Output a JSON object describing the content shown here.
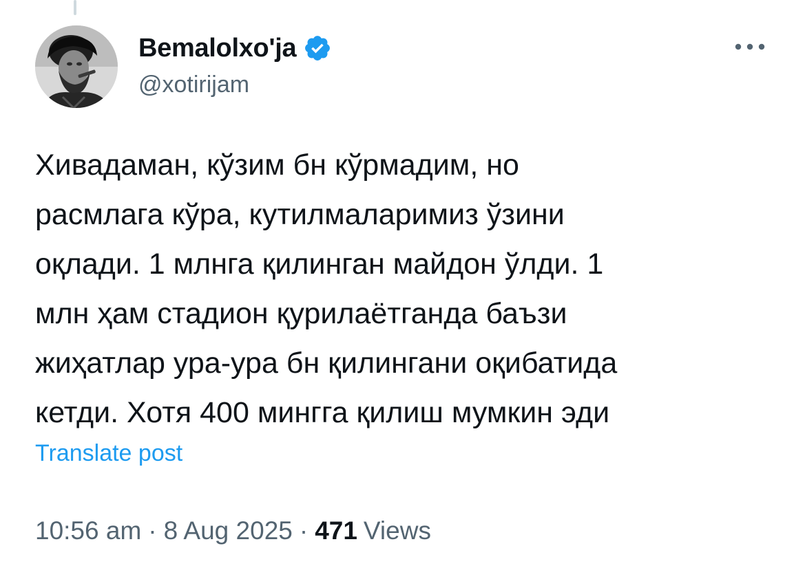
{
  "author": {
    "display_name": "Bemalolxo'ja",
    "handle": "@xotirijam",
    "verified": true,
    "avatar_icon": "avatar-photo"
  },
  "tweet": {
    "lines": [
      "Хивадаман, кўзим бн кўрмадим, но",
      "расмлага кўра, кутилмаларимиз ўзини",
      "оқлади. 1 млнга қилинган майдон ўлди. 1",
      "млн ҳам стадион қурилаётганда баъзи",
      "жиҳатлар ура-ура бн қилингани оқибатида",
      "кетди. Хотя 400 мингга қилиш мумкин эди"
    ],
    "translate_label": "Translate post"
  },
  "meta": {
    "time": "10:56 am",
    "separator": "·",
    "date": "8 Aug 2025",
    "views_count": "471",
    "views_label": "Views"
  },
  "colors": {
    "text_primary": "#0f1419",
    "text_secondary": "#536471",
    "link_blue": "#1d9bf0",
    "verified_blue": "#1d9bf0"
  },
  "icons": {
    "more": "more-horizontal-icon",
    "verified": "verified-badge-icon"
  }
}
